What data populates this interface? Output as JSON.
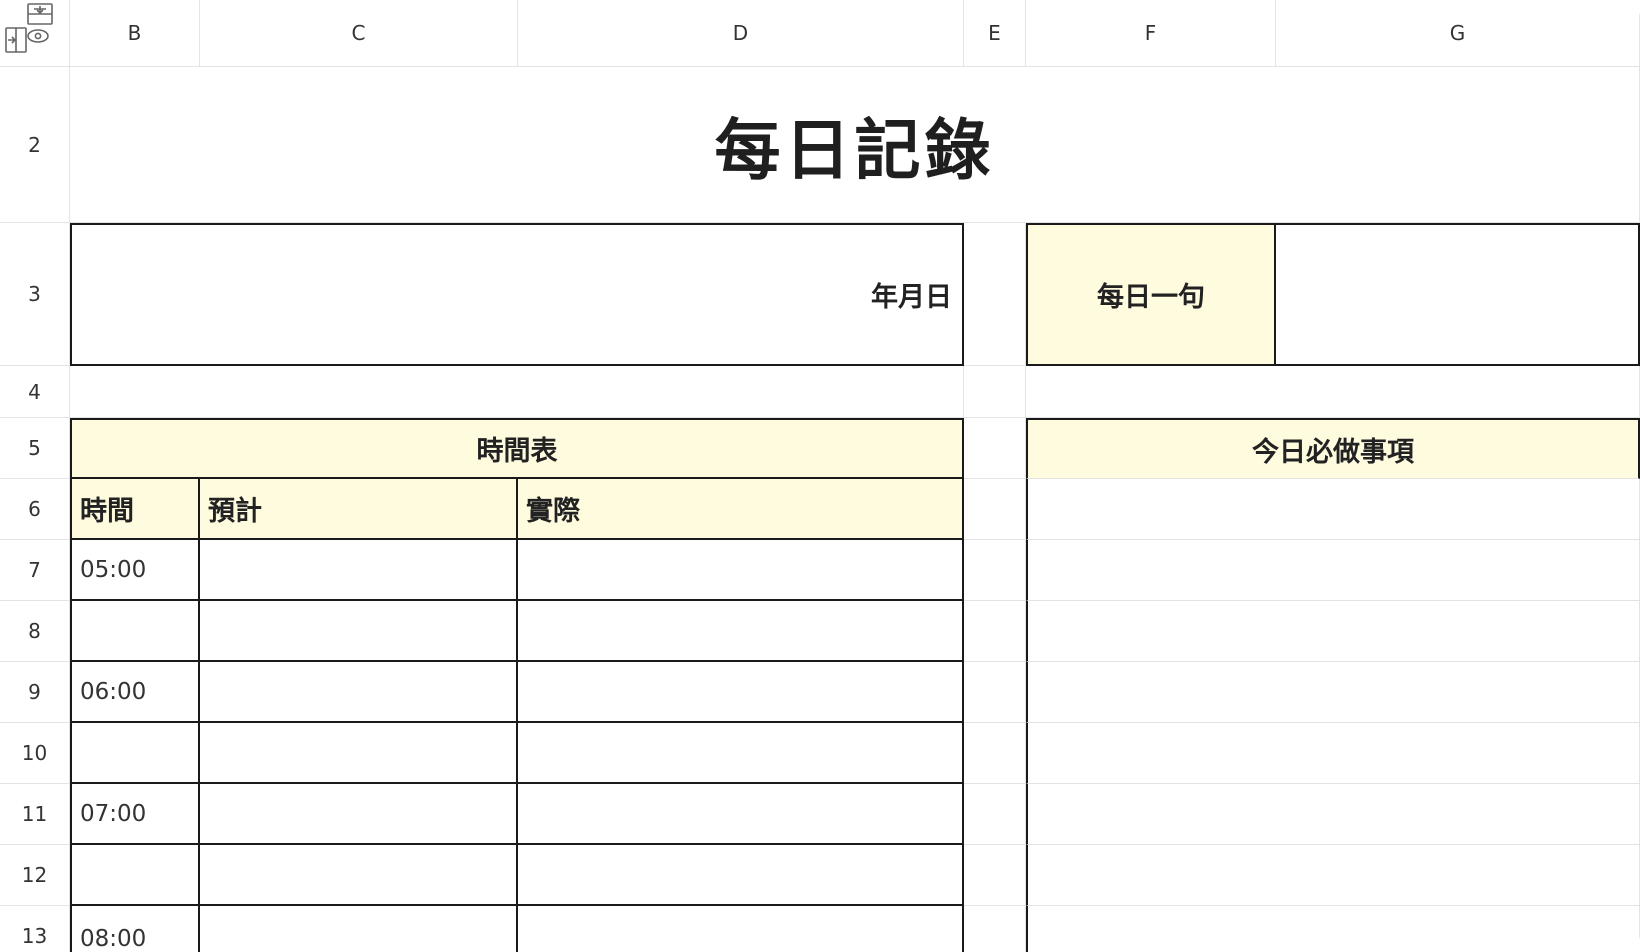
{
  "columns": [
    "B",
    "C",
    "D",
    "E",
    "F",
    "G"
  ],
  "rows": [
    "2",
    "3",
    "4",
    "5",
    "6",
    "7",
    "8",
    "9",
    "10",
    "11",
    "12",
    "13"
  ],
  "sheet": {
    "title": "每日記錄",
    "date_label": "年月日",
    "quote_label": "每日一句",
    "schedule_header": "時間表",
    "todo_header": "今日必做事項",
    "col_time": "時間",
    "col_planned": "預計",
    "col_actual": "實際",
    "times": [
      "05:00",
      "",
      "06:00",
      "",
      "07:00",
      "",
      "08:00"
    ]
  },
  "colors": {
    "highlight": "#fffbdf",
    "border_strong": "#1a1a1a",
    "grid_line": "#e3e3e3"
  },
  "icons": {
    "corner": "freeze-panes-icon"
  }
}
